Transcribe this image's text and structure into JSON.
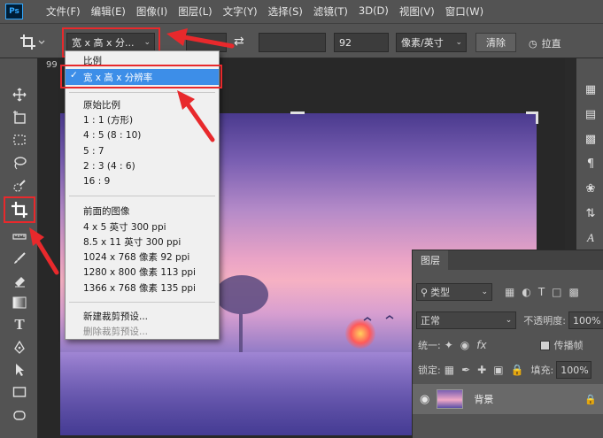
{
  "app": {
    "logo_text": "Ps"
  },
  "menu": [
    "文件(F)",
    "编辑(E)",
    "图像(I)",
    "图层(L)",
    "文字(Y)",
    "选择(S)",
    "滤镜(T)",
    "3D(D)",
    "视图(V)",
    "窗口(W)"
  ],
  "options_bar": {
    "crop_tool_icon": "crop-icon",
    "preset_value": "宽 x 高 x 分...",
    "resolution_value": "92",
    "unit_value": "像素/英寸",
    "clear_label": "清除",
    "straighten_label": "拉直"
  },
  "canvas": {
    "doc_tab_fragment": "99"
  },
  "dropdown": {
    "items": [
      {
        "label": "比例",
        "selected": false
      },
      {
        "label": "宽 x 高 x 分辨率",
        "selected": true
      },
      {
        "label": "原始比例"
      },
      {
        "label": "1 : 1 (方形)"
      },
      {
        "label": "4 : 5 (8 : 10)"
      },
      {
        "label": "5 : 7"
      },
      {
        "label": "2 : 3 (4 : 6)"
      },
      {
        "label": "16 : 9"
      },
      {
        "label": "前面的图像"
      },
      {
        "label": "4 x 5 英寸 300 ppi"
      },
      {
        "label": "8.5 x 11 英寸 300 ppi"
      },
      {
        "label": "1024 x 768 像素 92 ppi"
      },
      {
        "label": "1280 x 800 像素 113 ppi"
      },
      {
        "label": "1366 x 768 像素 135 ppi"
      },
      {
        "label": "新建裁剪预设..."
      },
      {
        "label": "删除裁剪预设...",
        "disabled": true
      }
    ]
  },
  "layers_panel": {
    "tab": "图层",
    "filter_label": "类型",
    "blend_mode": "正常",
    "opacity_label": "不透明度:",
    "opacity_value": "100%",
    "unify_label": "统一:",
    "propagate_label": "传播帧",
    "lock_label": "锁定:",
    "fill_label": "填充:",
    "fill_value": "100%",
    "layer_name": "背景"
  },
  "colors": {
    "highlight": "#3d8ee8",
    "annotation_red": "#e8292c"
  }
}
